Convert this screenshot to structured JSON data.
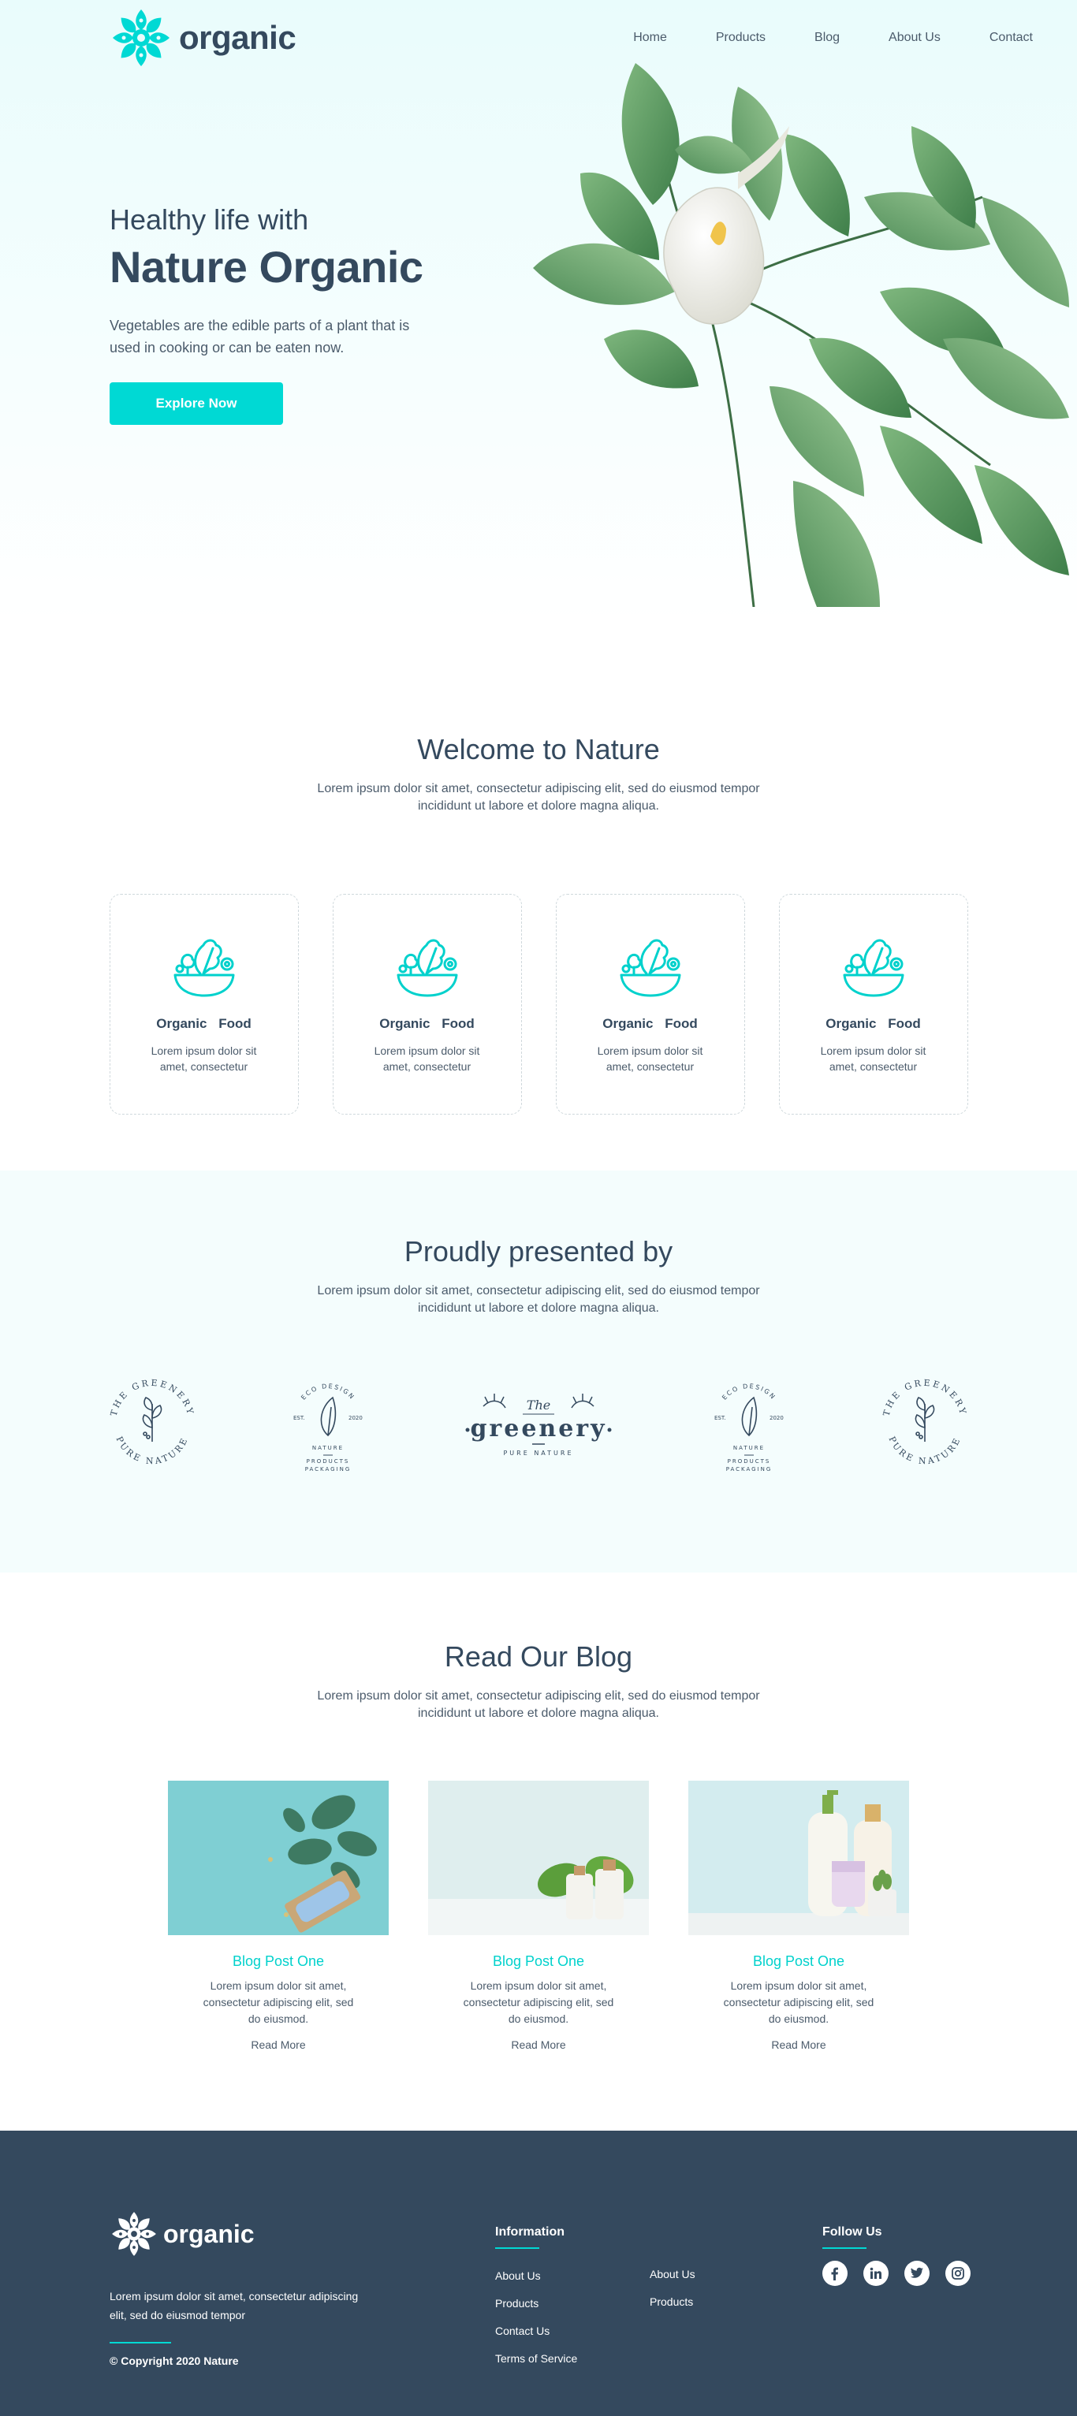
{
  "nav": {
    "brand": "organic",
    "links": [
      "Home",
      "Products",
      "Blog",
      "About Us",
      "Contact"
    ]
  },
  "hero": {
    "subtitle": "Healthy life with",
    "title": "Nature Organic",
    "description": "Vegetables are the edible parts of a plant that is used in cooking or can be eaten now.",
    "cta": "Explore Now"
  },
  "welcome": {
    "title": "Welcome to Nature",
    "description": "Lorem ipsum dolor sit amet, consectetur adipiscing elit, sed do eiusmod tempor incididunt ut labore et dolore magna aliqua.",
    "cards": [
      {
        "title": "Organic Food",
        "text": "Lorem ipsum dolor sit amet, consectetur"
      },
      {
        "title": "Organic Food",
        "text": "Lorem ipsum dolor sit amet, consectetur"
      },
      {
        "title": "Organic Food",
        "text": "Lorem ipsum dolor sit amet, consectetur"
      },
      {
        "title": "Organic Food",
        "text": "Lorem ipsum dolor sit amet, consectetur"
      }
    ]
  },
  "partners": {
    "title": "Proudly presented by",
    "description": "Lorem ipsum dolor sit amet, consectetur adipiscing elit, sed do eiusmod tempor incididunt ut labore et dolore magna aliqua.",
    "logos": {
      "greenery_ring_top": "THE GREENERY",
      "greenery_ring_bottom": "PURE NATURE",
      "eco_top": "ECO DESIGN",
      "eco_est": "EST.",
      "eco_year": "2020",
      "eco_nature": "NATURE",
      "eco_products": "PRODUCTS",
      "eco_packaging": "PACKAGING",
      "center_the": "The",
      "center_name": "greenery",
      "center_sub": "PURE NATURE"
    }
  },
  "blog": {
    "title": "Read Our Blog",
    "description": "Lorem ipsum dolor sit amet, consectetur adipiscing elit, sed do eiusmod tempor incididunt ut labore et dolore magna aliqua.",
    "posts": [
      {
        "title": "Blog Post One",
        "text": "Lorem ipsum dolor sit amet, consectetur adipiscing elit, sed do eiusmod.",
        "link": "Read More"
      },
      {
        "title": "Blog Post One",
        "text": "Lorem ipsum dolor sit amet, consectetur adipiscing elit, sed do eiusmod.",
        "link": "Read More"
      },
      {
        "title": "Blog Post One",
        "text": "Lorem ipsum dolor sit amet, consectetur adipiscing elit, sed do eiusmod.",
        "link": "Read More"
      }
    ]
  },
  "footer": {
    "brand": "organic",
    "description": "Lorem ipsum dolor sit amet, consectetur adipiscing elit, sed do eiusmod tempor",
    "copyright": "© Copyright 2020 Nature",
    "info_title": "Information",
    "info_col1": [
      "About Us",
      "Products",
      "Contact Us",
      "Terms of Service"
    ],
    "info_col2": [
      "About Us",
      "Products"
    ],
    "follow_title": "Follow Us",
    "socials": [
      "facebook-icon",
      "linkedin-icon",
      "twitter-icon",
      "instagram-icon"
    ]
  },
  "colors": {
    "accent": "#00d9d4",
    "text": "#34495e",
    "footer_bg": "#34495e"
  }
}
